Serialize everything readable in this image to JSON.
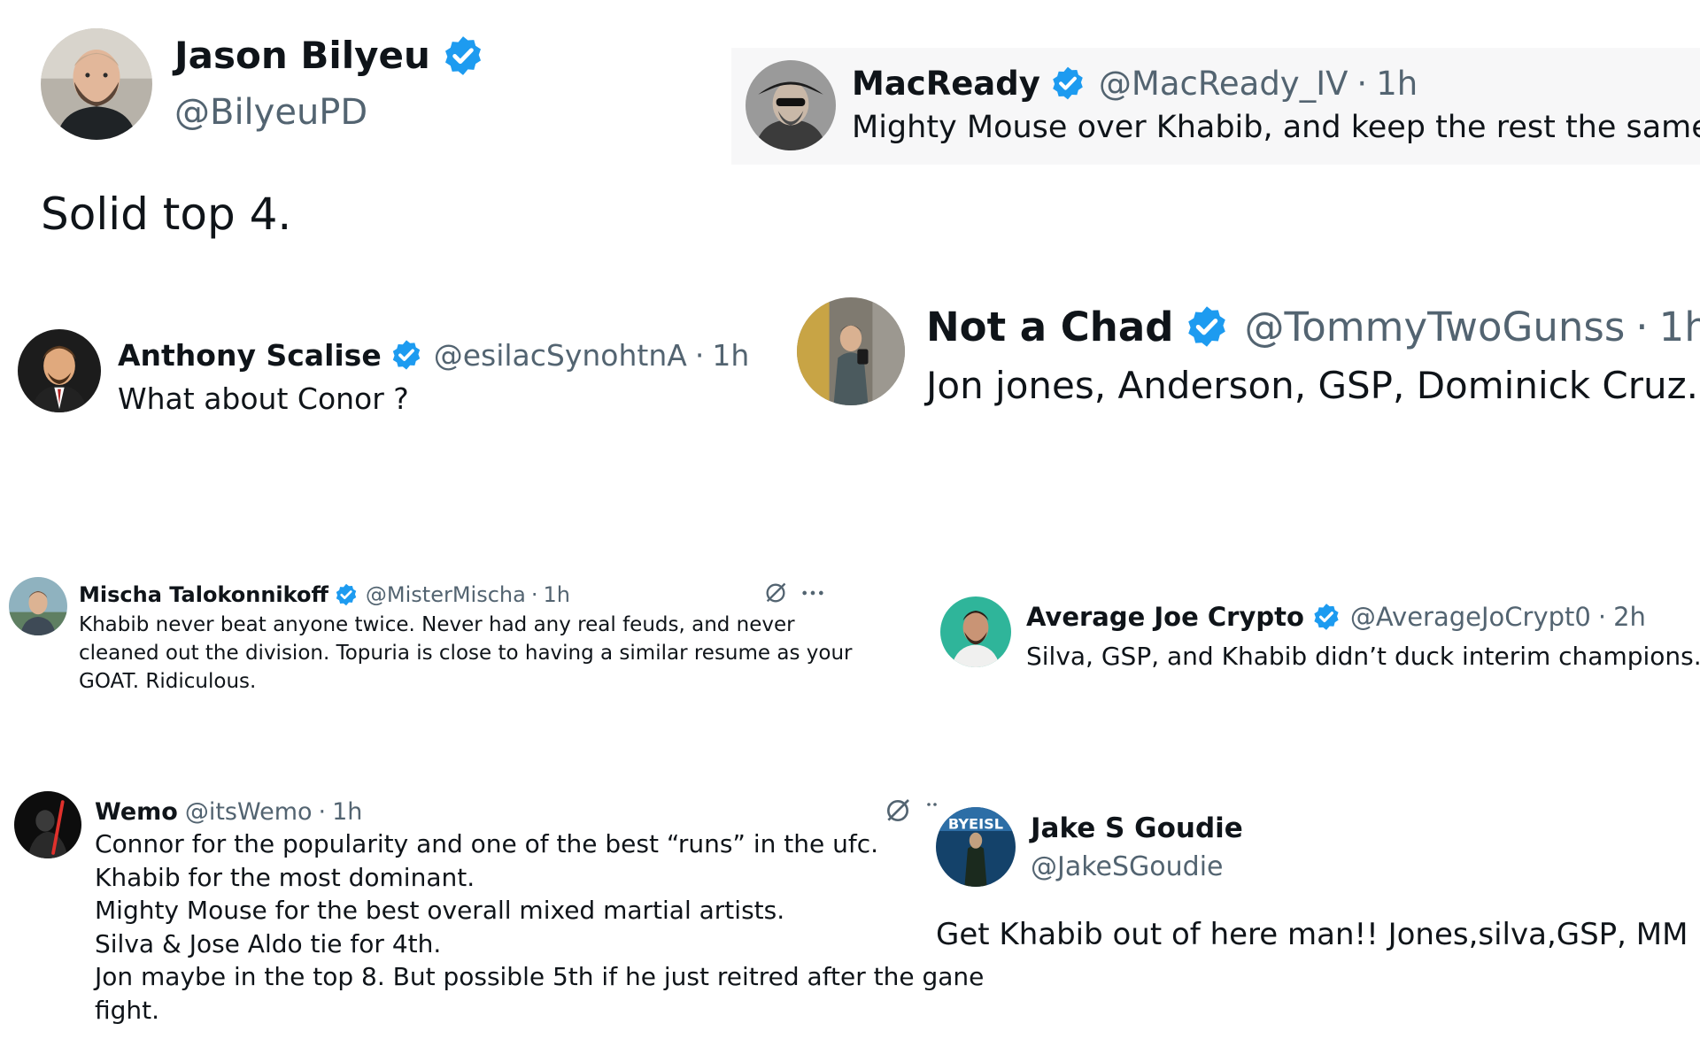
{
  "colors": {
    "verified_blue": "#1d9bf0",
    "text_primary": "#0f1419",
    "text_secondary": "#536471",
    "highlight_background": "#f7f7f8"
  },
  "tweets": [
    {
      "name": "Jason Bilyeu",
      "handle": "@BilyeuPD",
      "verified": true,
      "avatar": "profile-photo-man-beard",
      "body": [
        "Solid top 4."
      ]
    },
    {
      "name": "MacReady",
      "handle": "@MacReady_IV",
      "sep": "·",
      "time": "1h",
      "verified": true,
      "avatar": "profile-photo-man-hat-sunglasses",
      "body": [
        "Mighty Mouse over Khabib, and keep the rest the same."
      ]
    },
    {
      "name": "Anthony Scalise",
      "handle": "@esilacSynohtnA",
      "sep": "·",
      "time": "1h",
      "verified": true,
      "avatar": "profile-photo-cartoon-man-suit",
      "body": [
        "What about Conor ?"
      ]
    },
    {
      "name": "Not a Chad",
      "handle": "@TommyTwoGunss",
      "sep": "·",
      "time": "1h",
      "verified": true,
      "avatar": "profile-photo-gym-selfie",
      "body": [
        "Jon jones, Anderson, GSP, Dominick Cruz."
      ]
    },
    {
      "name": "Mischa Talokonnikoff",
      "handle": "@MisterMischa",
      "sep": "·",
      "time": "1h",
      "verified": true,
      "avatar": "profile-photo-man-outdoors",
      "icons": [
        "grok-icon",
        "more-icon"
      ],
      "body": [
        "Khabib never beat anyone twice. Never had any real feuds, and never",
        "cleaned out the division. Topuria is close to having a similar resume as your",
        "GOAT. Ridiculous."
      ]
    },
    {
      "name": "Average Joe Crypto",
      "handle": "@AverageJoCrypt0",
      "sep": "·",
      "time": "2h",
      "verified": true,
      "avatar": "profile-photo-man-beard-teal",
      "body": [
        "Silva, GSP, and Khabib didn’t duck interim champions."
      ]
    },
    {
      "name": "Wemo",
      "handle": "@itsWemo",
      "sep": "·",
      "time": "1h",
      "verified": false,
      "avatar": "profile-photo-dark-figure-lightsaber",
      "icons": [
        "grok-icon",
        "more-icon"
      ],
      "body": [
        "Connor for the popularity and one of the best “runs” in the ufc.",
        "Khabib for the most dominant.",
        "Mighty Mouse for the best overall mixed martial artists.",
        "Silva & Jose Aldo tie for 4th.",
        "Jon maybe in the top 8. But possible 5th if he just reitred after the gane",
        "fight."
      ]
    },
    {
      "name": "Jake S Goudie",
      "handle": "@JakeSGoudie",
      "verified": false,
      "avatar": "profile-photo-blue-poster",
      "avatar_text": "BYEISL",
      "body": [
        "Get Khabib out of here man!! Jones,silva,GSP, MM"
      ]
    }
  ]
}
